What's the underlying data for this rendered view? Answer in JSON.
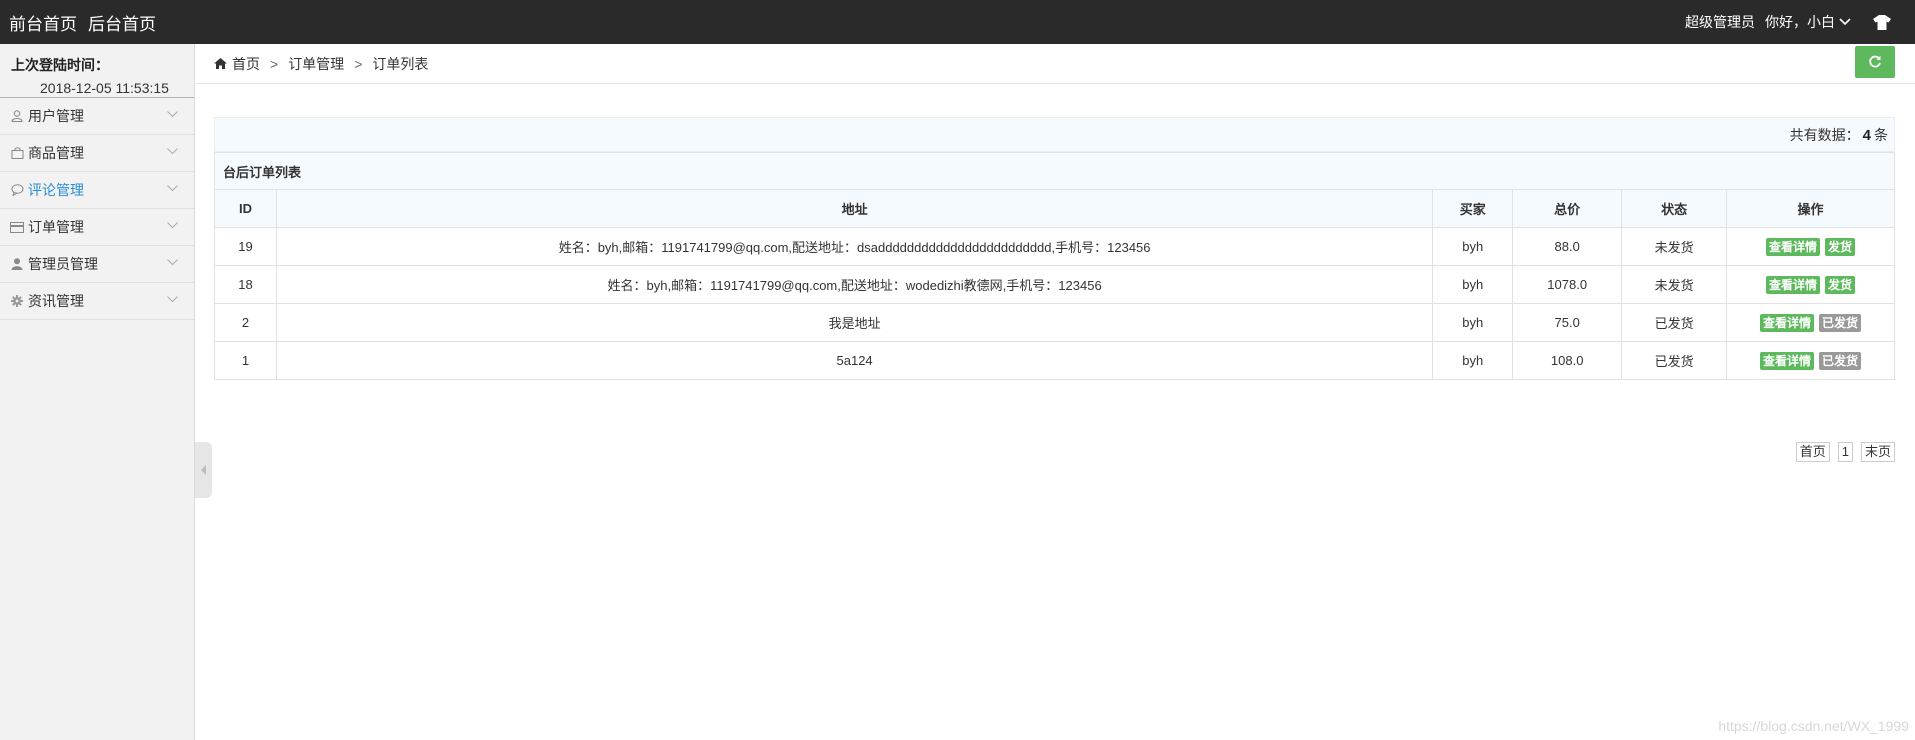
{
  "header": {
    "nav": [
      "前台首页",
      "后台首页"
    ],
    "role": "超级管理员",
    "greeting": "你好，小白",
    "shirt_icon": "tshirt-icon"
  },
  "sidebar": {
    "last_login_label": "上次登陆时间：",
    "last_login_time": "2018-12-05 11:53:15",
    "items": [
      {
        "label": "用户管理",
        "icon": "user-icon"
      },
      {
        "label": "商品管理",
        "icon": "bag-icon"
      },
      {
        "label": "评论管理",
        "icon": "comment-icon",
        "active": true
      },
      {
        "label": "订单管理",
        "icon": "card-icon"
      },
      {
        "label": "管理员管理",
        "icon": "admin-icon"
      },
      {
        "label": "资讯管理",
        "icon": "gear-icon"
      }
    ]
  },
  "breadcrumb": [
    "首页",
    "订单管理",
    "订单列表"
  ],
  "count": {
    "prefix": "共有数据：",
    "value": "4",
    "suffix": "条"
  },
  "table": {
    "caption": "台后订单列表",
    "columns": [
      "ID",
      "地址",
      "买家",
      "总价",
      "状态",
      "操作"
    ],
    "rows": [
      {
        "id": "19",
        "address": "姓名：byh,邮箱：1191741799@qq.com,配送地址：dsadddddddddddddddddddddddd,手机号：123456",
        "buyer": "byh",
        "price": "88.0",
        "status": "未发货",
        "actions": [
          "查看详情",
          "发货"
        ]
      },
      {
        "id": "18",
        "address": "姓名：byh,邮箱：1191741799@qq.com,配送地址：wodedizhi教德网,手机号：123456",
        "buyer": "byh",
        "price": "1078.0",
        "status": "未发货",
        "actions": [
          "查看详情",
          "发货"
        ]
      },
      {
        "id": "2",
        "address": "我是地址",
        "buyer": "byh",
        "price": "75.0",
        "status": "已发货",
        "actions": [
          "查看详情",
          "已发货"
        ]
      },
      {
        "id": "1",
        "address": "5a124",
        "buyer": "byh",
        "price": "108.0",
        "status": "已发货",
        "actions": [
          "查看详情",
          "已发货"
        ]
      }
    ]
  },
  "pager": {
    "first": "首页",
    "page": "1",
    "last": "末页"
  },
  "watermark": "https://blog.csdn.net/WX_1999",
  "colors": {
    "topbar": "#2a2a2a",
    "green": "#5eb95e",
    "gray": "#999999",
    "active": "#2b8ed8"
  }
}
